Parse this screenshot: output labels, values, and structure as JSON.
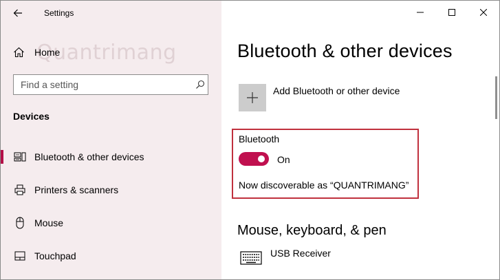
{
  "window": {
    "title": "Settings",
    "controls": [
      "minimize",
      "maximize",
      "close"
    ]
  },
  "sidebar": {
    "home_label": "Home",
    "watermark": "Quantrimang",
    "search": {
      "value": "",
      "placeholder": "Find a setting"
    },
    "section_heading": "Devices",
    "items": [
      {
        "label": "Bluetooth & other devices",
        "icon": "bluetooth-devices-icon",
        "active": true
      },
      {
        "label": "Printers & scanners",
        "icon": "printer-icon",
        "active": false
      },
      {
        "label": "Mouse",
        "icon": "mouse-icon",
        "active": false
      },
      {
        "label": "Touchpad",
        "icon": "touchpad-icon",
        "active": false
      }
    ]
  },
  "main": {
    "title": "Bluetooth & other devices",
    "add_device_label": "Add Bluetooth or other device",
    "bluetooth": {
      "label": "Bluetooth",
      "state_label": "On",
      "is_on": true,
      "discoverable_text": "Now discoverable as “QUANTRIMANG”"
    },
    "section_heading": "Mouse, keyboard, & pen",
    "devices": [
      {
        "name": "USB Receiver",
        "icon": "keyboard-icon"
      }
    ]
  },
  "colors": {
    "accent": "#c0104f",
    "highlight_box": "#c0303d",
    "sidebar_bg": "#f5ecee",
    "tile_bg": "#cccccc"
  }
}
